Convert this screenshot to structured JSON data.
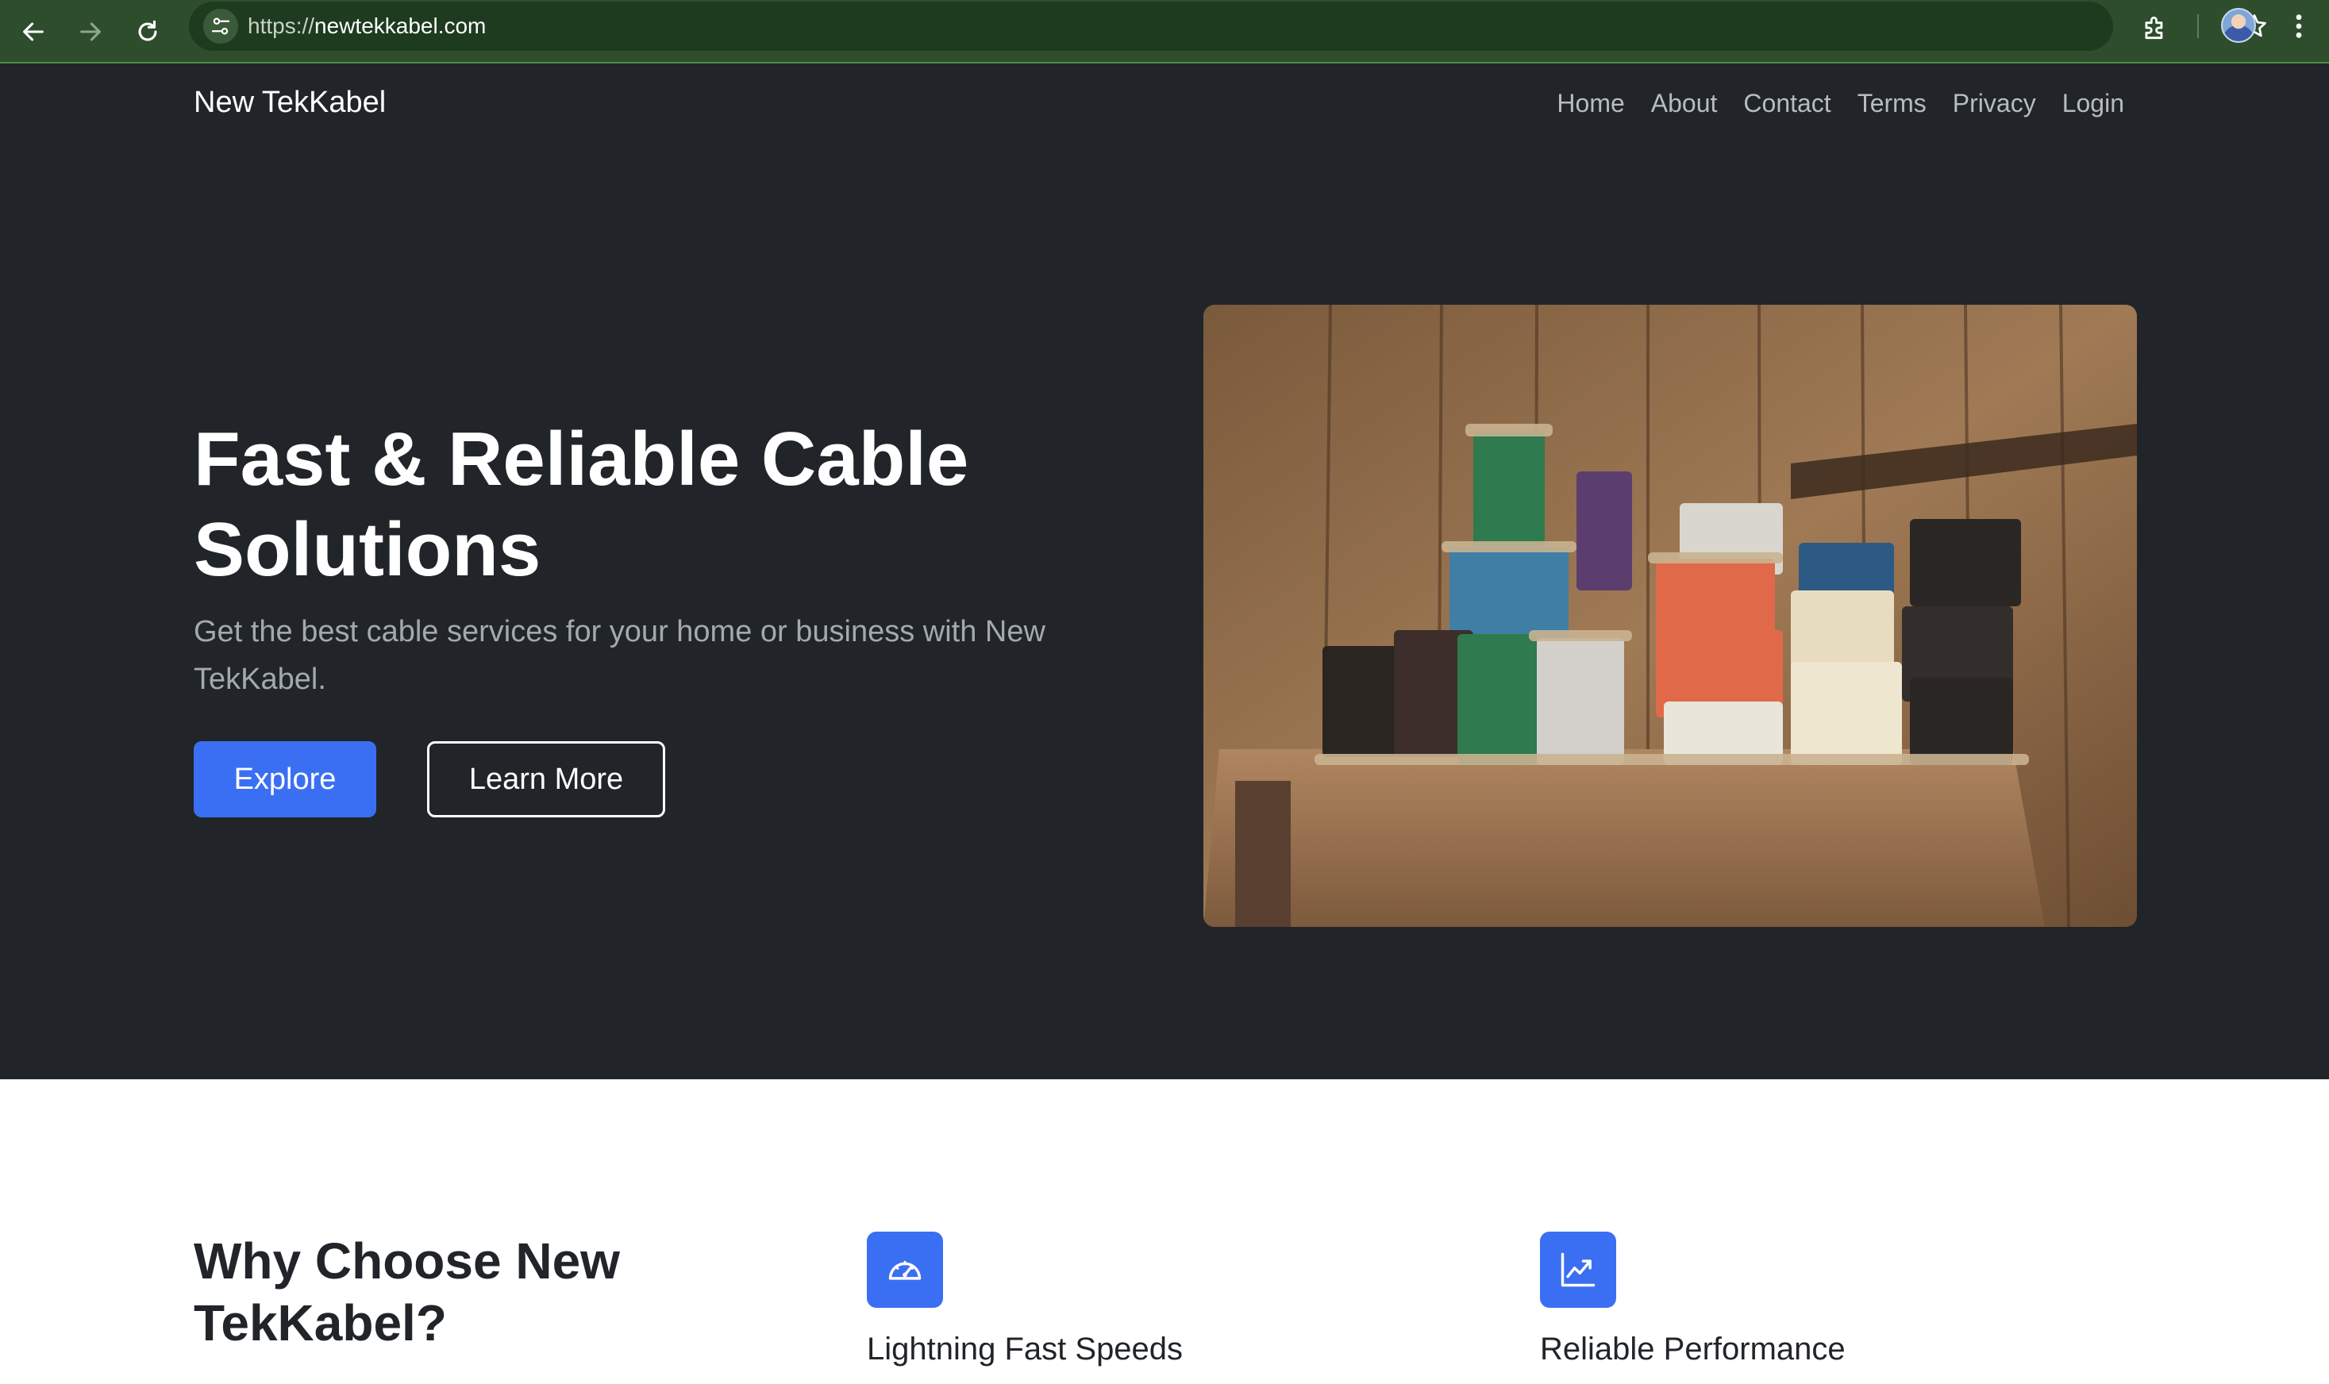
{
  "browser": {
    "url_scheme": "https://",
    "url_host": "newtekkabel.com",
    "icons": [
      "back-arrow-icon",
      "forward-arrow-icon",
      "reload-icon",
      "site-info-icon",
      "bookmark-star-icon",
      "extensions-icon",
      "profile-avatar",
      "menu-dots-icon"
    ]
  },
  "site": {
    "brand": "New TekKabel",
    "nav": [
      "Home",
      "About",
      "Contact",
      "Terms",
      "Privacy",
      "Login"
    ]
  },
  "hero": {
    "title": "Fast & Reliable Cable Solutions",
    "subtitle": "Get the best cable services for your home or business with New TekKabel.",
    "primary_button": "Explore",
    "secondary_button": "Learn More",
    "image_icon": "wire-spools-photo",
    "primary_color": "#3b6ff3",
    "background_color": "#212529"
  },
  "features": {
    "heading": "Why Choose New TekKabel?",
    "items": [
      {
        "title": "Lightning Fast Speeds",
        "icon": "speedometer-icon"
      },
      {
        "title": "Reliable Performance",
        "icon": "graph-up-icon"
      }
    ]
  }
}
